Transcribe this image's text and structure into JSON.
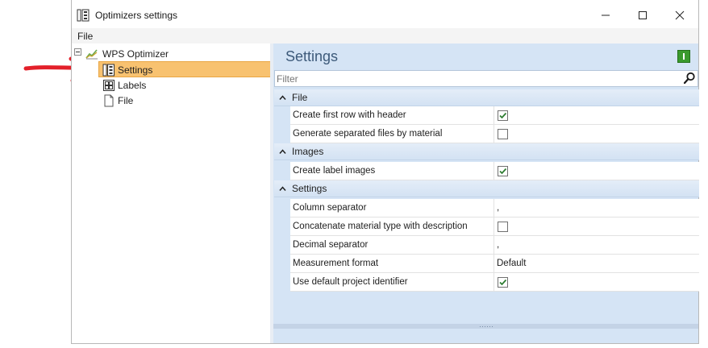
{
  "window": {
    "title": "Optimizers settings"
  },
  "menu": {
    "file": "File"
  },
  "tree": {
    "root": "WPS Optimizer",
    "items": [
      {
        "label": "Settings",
        "selected": true
      },
      {
        "label": "Labels",
        "selected": false
      },
      {
        "label": "File",
        "selected": false
      }
    ]
  },
  "panel": {
    "title": "Settings",
    "filter_placeholder": "Filter"
  },
  "grid": {
    "categories": [
      {
        "label": "File",
        "rows": [
          {
            "name": "Create first row with header",
            "type": "checkbox",
            "checked": true
          },
          {
            "name": "Generate separated files by material",
            "type": "checkbox",
            "checked": false
          }
        ]
      },
      {
        "label": "Images",
        "rows": [
          {
            "name": "Create label images",
            "type": "checkbox",
            "checked": true
          }
        ]
      },
      {
        "label": "Settings",
        "rows": [
          {
            "name": "Column separator",
            "type": "text",
            "value": ","
          },
          {
            "name": "Concatenate material type with description",
            "type": "checkbox",
            "checked": false
          },
          {
            "name": "Decimal separator",
            "type": "text",
            "value": ","
          },
          {
            "name": "Measurement format",
            "type": "text",
            "value": "Default"
          },
          {
            "name": "Use default project identifier",
            "type": "checkbox",
            "checked": true
          }
        ]
      }
    ]
  },
  "colors": {
    "selection": "#f8c270",
    "panel_bg": "#d5e4f5",
    "accent_green": "#3b9a2d",
    "arrow": "#e3202a"
  }
}
